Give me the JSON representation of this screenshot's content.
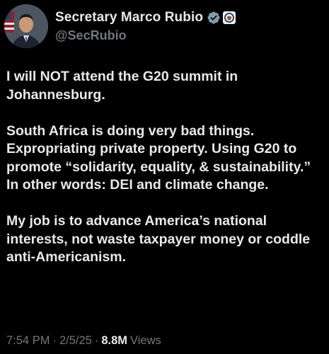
{
  "author": {
    "display_name": "Secretary Marco Rubio",
    "handle": "@SecRubio",
    "verified_badge_color": "#829aab",
    "affiliation_badge": "seal-icon"
  },
  "tweet": {
    "paragraphs": [
      "I will NOT attend the G20 summit in Johannesburg.",
      "South Africa is doing very bad things. Expropriating private property. Using G20 to promote “solidarity, equality, & sustainability.” In other words: DEI and climate change.",
      "My job is to advance America’s national interests, not waste taxpayer money or coddle anti-Americanism."
    ]
  },
  "meta": {
    "time": "7:54 PM",
    "date": "2/5/25",
    "separator": "·",
    "views_count": "8.8M",
    "views_label": "Views"
  },
  "colors": {
    "background": "#000000",
    "text_primary": "#e7e9ea",
    "text_secondary": "#71767b"
  }
}
